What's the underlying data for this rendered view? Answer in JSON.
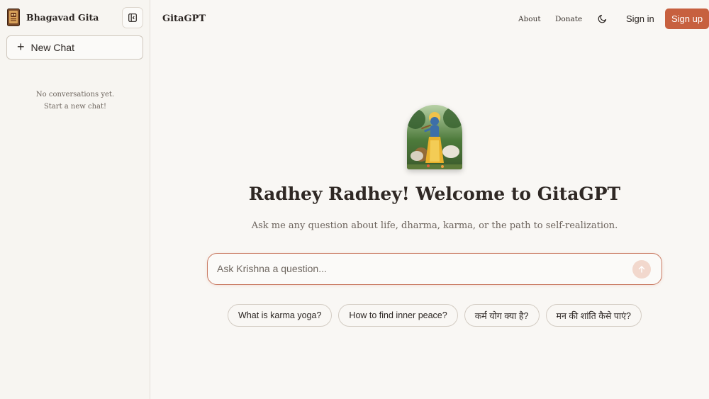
{
  "sidebar": {
    "brand": "Bhagavad Gita",
    "new_chat_label": "New Chat",
    "empty_line1": "No conversations yet.",
    "empty_line2": "Start a new chat!"
  },
  "header": {
    "title": "GitaGPT",
    "about": "About",
    "donate": "Donate",
    "theme_icon": "moon-icon",
    "sign_in": "Sign in",
    "sign_up": "Sign up"
  },
  "main": {
    "headline": "Radhey Radhey! Welcome to GitaGPT",
    "subtitle": "Ask me any question about life, dharma, karma, or the path to self-realization.",
    "input_placeholder": "Ask Krishna a question...",
    "input_value": "",
    "suggestions": [
      "What is karma yoga?",
      "How to find inner peace?",
      "कर्म योग क्या है?",
      "मन की शांति कैसे पाएं?"
    ]
  },
  "colors": {
    "accent": "#c7603f",
    "background": "#f9f7f4",
    "sidebar_bg": "#f7f5f1"
  }
}
